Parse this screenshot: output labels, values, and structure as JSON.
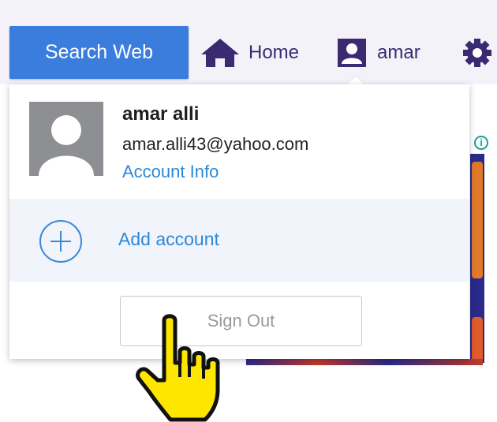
{
  "header": {
    "search_label": "Search Web",
    "home_label": "Home",
    "user_label": "amar"
  },
  "profile": {
    "name": "amar alli",
    "email": "amar.alli43@yahoo.com",
    "account_link": "Account Info"
  },
  "add_account_label": "Add account",
  "sign_out_label": "Sign Out",
  "icons": {
    "home": "home-icon",
    "user": "user-icon",
    "gear": "gear-icon",
    "info": "info-icon",
    "add": "plus-circle-icon",
    "avatar": "avatar-placeholder",
    "cursor": "hand-pointer-icon"
  },
  "colors": {
    "brand_purple": "#3a2a72",
    "search_blue": "#3b7ddd",
    "link_blue": "#2d88d8",
    "cursor_yellow": "#ffe600"
  }
}
